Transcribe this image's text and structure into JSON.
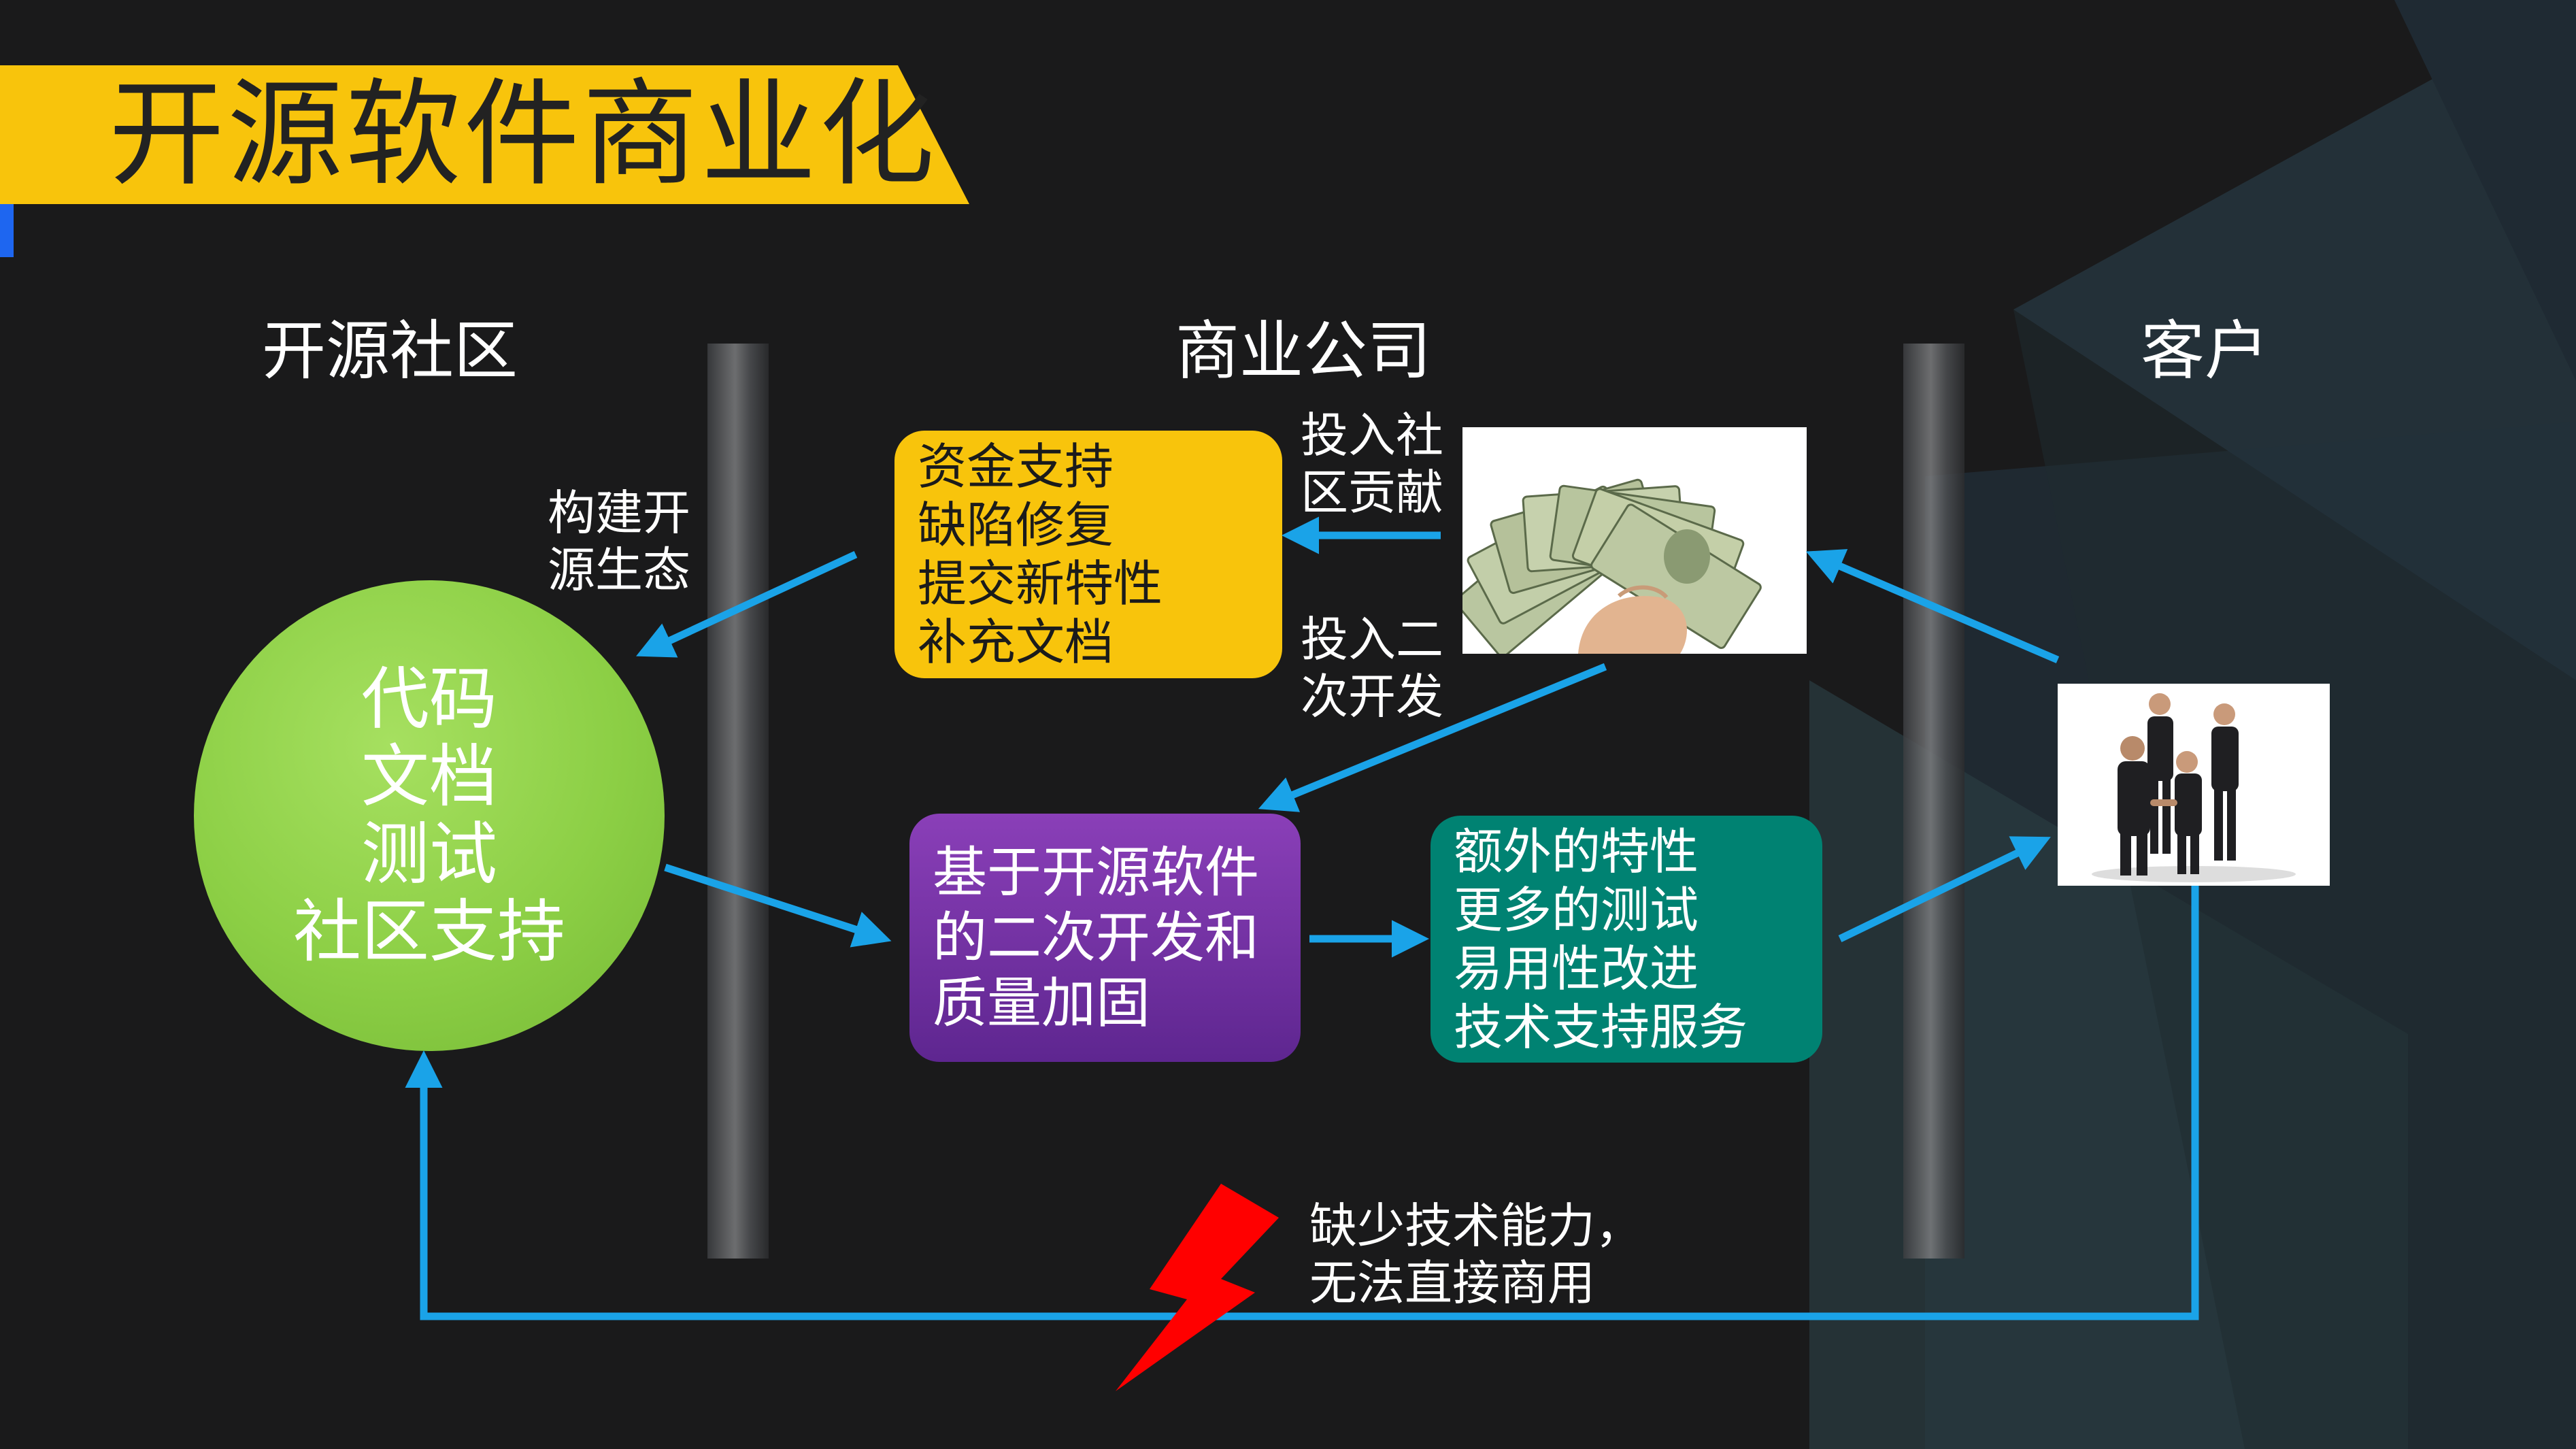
{
  "title": "开源软件商业化",
  "columns": {
    "community": "开源社区",
    "company": "商业公司",
    "customer": "客户"
  },
  "community_circle": {
    "lines": [
      "代码",
      "文档",
      "测试",
      "社区支持"
    ]
  },
  "contribution_box": {
    "lines": [
      "资金支持",
      "缺陷修复",
      "提交新特性",
      "补充文档"
    ]
  },
  "secondary_dev_box": {
    "lines": [
      "基于开源软件",
      "的二次开发和",
      "质量加固"
    ]
  },
  "value_add_box": {
    "lines": [
      "额外的特性",
      "更多的测试",
      "易用性改进",
      "技术支持服务"
    ]
  },
  "labels": {
    "build_ecosystem": [
      "构建开",
      "源生态"
    ],
    "invest_community": [
      "投入社",
      "区贡献"
    ],
    "invest_secondary": [
      "投入二",
      "次开发"
    ],
    "lack_capability": [
      "缺少技术能力，",
      "无法直接商用"
    ]
  },
  "icons": {
    "money": "money-icon",
    "handshake": "handshake-icon",
    "lightning": "lightning-icon"
  },
  "colors": {
    "background": "#1a1a1b",
    "banner": "#f8c40c",
    "accent": "#1e66f0",
    "arrow": "#1aa3e8",
    "circle": "#8ccf45",
    "yellow_box": "#f8c40c",
    "purple_box": "#7030a0",
    "teal_box": "#008272",
    "lightning": "#ff0000"
  }
}
